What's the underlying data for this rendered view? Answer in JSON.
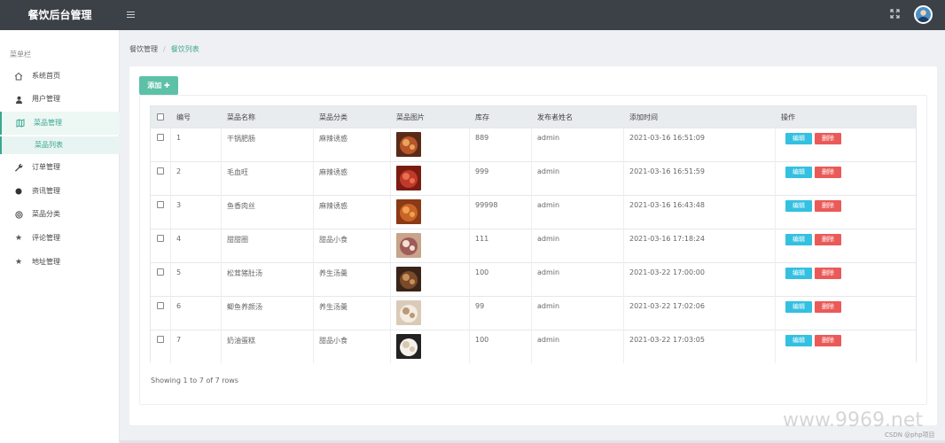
{
  "header": {
    "brand": "餐饮后台管理"
  },
  "sidebar": {
    "title": "菜单栏",
    "items": [
      {
        "label": "系统首页",
        "icon": "home-icon"
      },
      {
        "label": "用户管理",
        "icon": "user-icon"
      },
      {
        "label": "菜品管理",
        "icon": "map-icon",
        "active": true
      },
      {
        "label": "订单管理",
        "icon": "wrench-icon"
      },
      {
        "label": "资讯管理",
        "icon": "circle-icon"
      },
      {
        "label": "菜品分类",
        "icon": "target-icon"
      },
      {
        "label": "评论管理",
        "icon": "star-icon"
      },
      {
        "label": "地址管理",
        "icon": "star-icon"
      }
    ],
    "sub_item": "菜品列表"
  },
  "breadcrumb": {
    "parent": "餐饮管理",
    "separator": "/",
    "current": "餐饮列表"
  },
  "toolbar": {
    "add_label": "添加 ✚"
  },
  "table": {
    "columns": [
      "编号",
      "菜品名称",
      "菜品分类",
      "菜品图片",
      "库存",
      "发布者姓名",
      "添加时间",
      "操作"
    ],
    "rows": [
      {
        "id": "1",
        "name": "干锅肥肠",
        "category": "麻辣诱惑",
        "stock": "889",
        "publisher": "admin",
        "time": "2021-03-16 16:51:09"
      },
      {
        "id": "2",
        "name": "毛血旺",
        "category": "麻辣诱惑",
        "stock": "999",
        "publisher": "admin",
        "time": "2021-03-16 16:51:59"
      },
      {
        "id": "3",
        "name": "鱼香肉丝",
        "category": "麻辣诱惑",
        "stock": "99998",
        "publisher": "admin",
        "time": "2021-03-16 16:43:48"
      },
      {
        "id": "4",
        "name": "甜甜圈",
        "category": "甜品小食",
        "stock": "111",
        "publisher": "admin",
        "time": "2021-03-16 17:18:24"
      },
      {
        "id": "5",
        "name": "松茸猪肚汤",
        "category": "养生汤羹",
        "stock": "100",
        "publisher": "admin",
        "time": "2021-03-22 17:00:00"
      },
      {
        "id": "6",
        "name": "鲫鱼养颜汤",
        "category": "养生汤羹",
        "stock": "99",
        "publisher": "admin",
        "time": "2021-03-22 17:02:06"
      },
      {
        "id": "7",
        "name": "奶油蛋糕",
        "category": "甜品小食",
        "stock": "100",
        "publisher": "admin",
        "time": "2021-03-22 17:03:05"
      }
    ],
    "edit_label": "编辑",
    "delete_label": "删除"
  },
  "pagination": {
    "summary": "Showing 1 to 7 of 7 rows"
  },
  "watermark": {
    "site": "www.9969.net",
    "credit": "CSDN @php项目"
  },
  "colors": {
    "topbar": "#3c4147",
    "accent": "#3aa890",
    "edit": "#34c0e0",
    "delete": "#ea5a58"
  }
}
